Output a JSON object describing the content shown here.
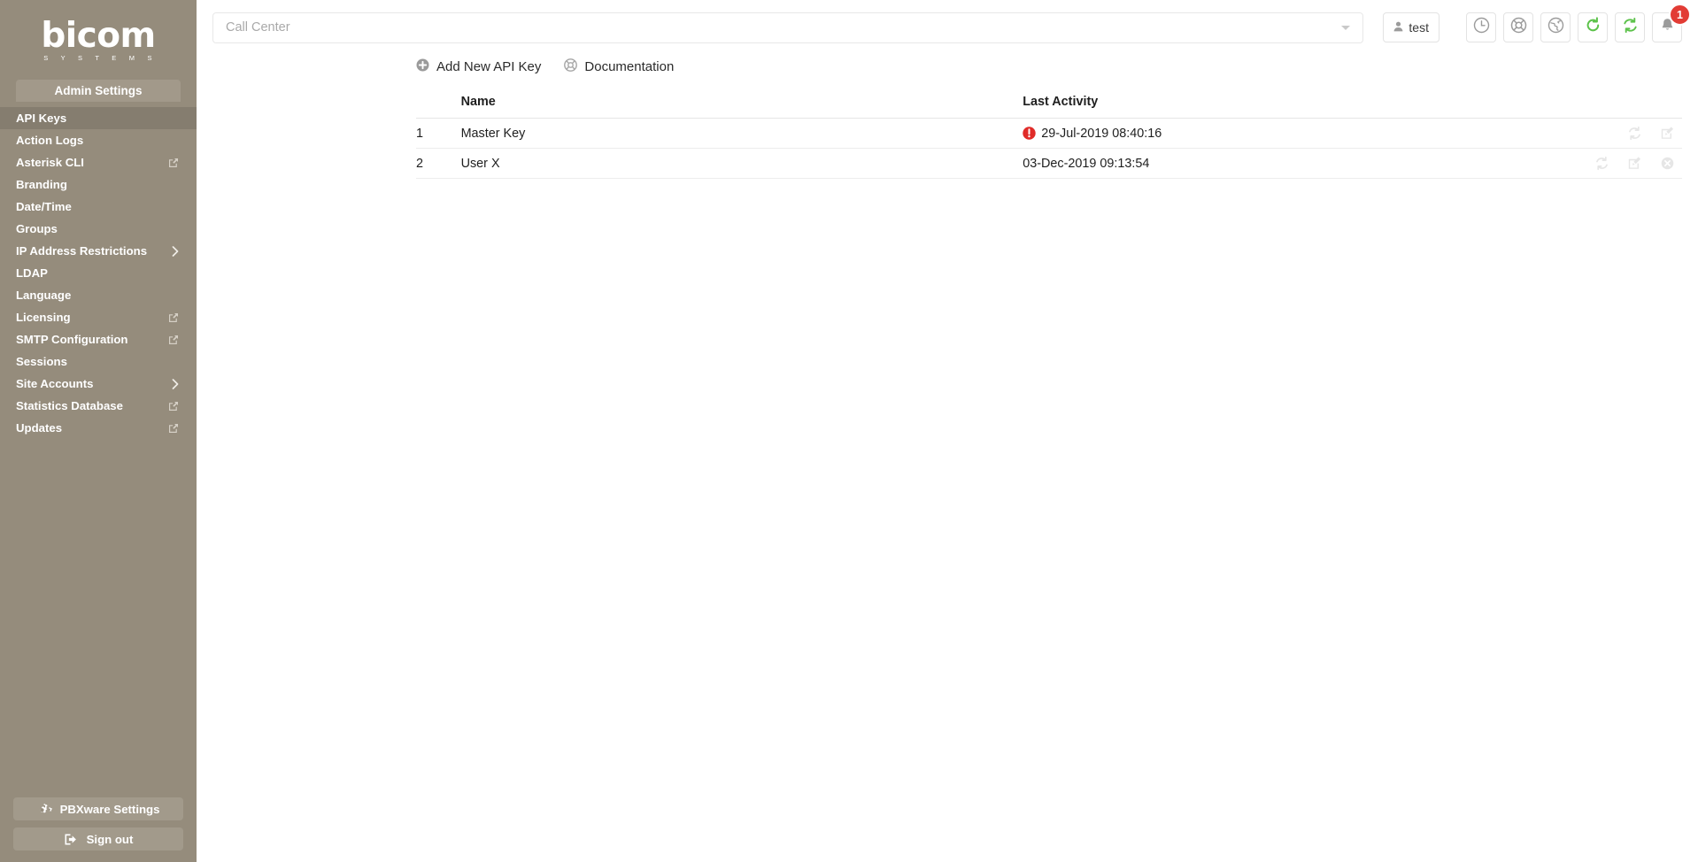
{
  "brand": {
    "logo_text": "bicom",
    "logo_sub": "S Y S T E M S",
    "sidebar_bg": "#958c7c",
    "sidebar_active_bg": "#857d6f",
    "accent_green": "#5cc24a",
    "accent_red": "#e23c35"
  },
  "sidebar": {
    "title": "Admin Settings",
    "items": [
      {
        "label": "API Keys",
        "active": true,
        "ext": false,
        "arrow": false
      },
      {
        "label": "Action Logs",
        "active": false,
        "ext": false,
        "arrow": false
      },
      {
        "label": "Asterisk CLI",
        "active": false,
        "ext": true,
        "arrow": false
      },
      {
        "label": "Branding",
        "active": false,
        "ext": false,
        "arrow": false
      },
      {
        "label": "Date/Time",
        "active": false,
        "ext": false,
        "arrow": false
      },
      {
        "label": "Groups",
        "active": false,
        "ext": false,
        "arrow": false
      },
      {
        "label": "IP Address Restrictions",
        "active": false,
        "ext": false,
        "arrow": true
      },
      {
        "label": "LDAP",
        "active": false,
        "ext": false,
        "arrow": false
      },
      {
        "label": "Language",
        "active": false,
        "ext": false,
        "arrow": false
      },
      {
        "label": "Licensing",
        "active": false,
        "ext": true,
        "arrow": false
      },
      {
        "label": "SMTP Configuration",
        "active": false,
        "ext": true,
        "arrow": false
      },
      {
        "label": "Sessions",
        "active": false,
        "ext": false,
        "arrow": false
      },
      {
        "label": "Site Accounts",
        "active": false,
        "ext": false,
        "arrow": true
      },
      {
        "label": "Statistics Database",
        "active": false,
        "ext": true,
        "arrow": false
      },
      {
        "label": "Updates",
        "active": false,
        "ext": true,
        "arrow": false
      }
    ],
    "bottom_buttons": [
      {
        "label": "PBXware Settings",
        "icon": "gears-icon"
      },
      {
        "label": "Sign out",
        "icon": "sign-out-icon"
      }
    ]
  },
  "topbar": {
    "tenant_select": {
      "value": "",
      "placeholder": "Call Center"
    },
    "user_button": {
      "label": "test",
      "icon": "user-icon"
    },
    "icon_buttons": [
      {
        "name": "clock-icon",
        "title": ""
      },
      {
        "name": "lifebuoy-icon",
        "title": ""
      },
      {
        "name": "globe-icon",
        "title": ""
      },
      {
        "name": "refresh-icon",
        "title": ""
      },
      {
        "name": "sync-icon",
        "title": ""
      },
      {
        "name": "bell-icon",
        "title": "",
        "badge": "1"
      }
    ]
  },
  "actions": [
    {
      "label": "Add New API Key",
      "icon": "plus-circle-icon"
    },
    {
      "label": "Documentation",
      "icon": "lifebuoy-icon"
    }
  ],
  "table": {
    "columns": [
      "",
      "Name",
      "Last Activity",
      ""
    ],
    "rows": [
      {
        "index": "1",
        "name": "Master Key",
        "last_activity": "29-Jul-2019 08:40:16",
        "has_warning": true,
        "ops": [
          "sync-icon",
          "edit-icon"
        ]
      },
      {
        "index": "2",
        "name": "User X",
        "last_activity": "03-Dec-2019 09:13:54",
        "has_warning": false,
        "ops": [
          "sync-icon",
          "edit-icon",
          "delete-icon"
        ]
      }
    ]
  }
}
